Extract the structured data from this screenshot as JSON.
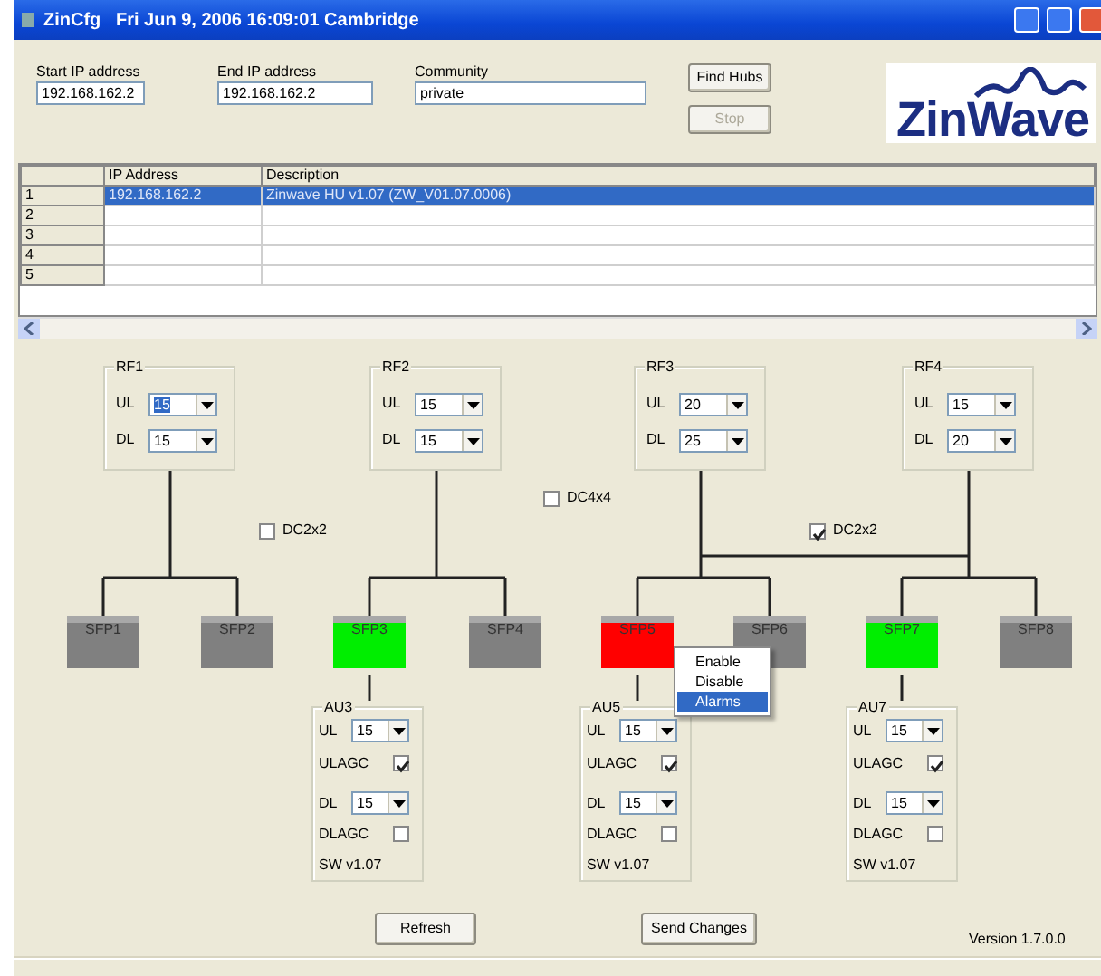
{
  "window": {
    "title": "ZinCfg   Fri Jun 9, 2006 16:09:01 Cambridge"
  },
  "fields": [
    {
      "label": "Start IP address",
      "value": "192.168.162.2"
    },
    {
      "label": "End IP address",
      "value": "192.168.162.2"
    },
    {
      "label": "Community",
      "value": "private"
    }
  ],
  "buttons": [
    {
      "label": "Find Hubs",
      "disabled": false
    },
    {
      "label": "Stop",
      "disabled": true
    }
  ],
  "logo": {
    "text": "ZinWave"
  },
  "table": {
    "columns": [
      "IP Address",
      "Description"
    ],
    "rows": [
      {
        "number": "1",
        "ip": "192.168.162.2",
        "description": "Zinwave HU v1.07 (ZW_V01.07.0006)",
        "selected": true
      },
      {
        "number": "2",
        "selected": false
      },
      {
        "number": "3",
        "selected": false
      },
      {
        "number": "4",
        "selected": false
      },
      {
        "number": "5",
        "selected": false
      }
    ]
  },
  "rf_units": [
    {
      "title": "RF1",
      "ul_label": "UL",
      "ul": "15",
      "dl_label": "DL",
      "dl": "15",
      "ul_highlighted": true
    },
    {
      "title": "RF2",
      "ul_label": "UL",
      "ul": "15",
      "dl_label": "DL",
      "dl": "15",
      "ul_highlighted": false
    },
    {
      "title": "RF3",
      "ul_label": "UL",
      "ul": "20",
      "dl_label": "DL",
      "dl": "25",
      "ul_highlighted": false
    },
    {
      "title": "RF4",
      "ul_label": "UL",
      "ul": "15",
      "dl_label": "DL",
      "dl": "20",
      "ul_highlighted": false
    }
  ],
  "combiners": [
    {
      "label": "DC2x2",
      "checked": false
    },
    {
      "label": "DC4x4",
      "checked": false
    },
    {
      "label": "DC2x2",
      "checked": true
    }
  ],
  "sfps": [
    {
      "label": "SFP1",
      "color": "#808080"
    },
    {
      "label": "SFP2",
      "color": "#808080"
    },
    {
      "label": "SFP3",
      "color": "#00ee00"
    },
    {
      "label": "SFP4",
      "color": "#808080"
    },
    {
      "label": "SFP5",
      "color": "#ff0000"
    },
    {
      "label": "SFP6",
      "color": "#808080"
    },
    {
      "label": "SFP7",
      "color": "#00ee00"
    },
    {
      "label": "SFP8",
      "color": "#808080"
    }
  ],
  "au_units": [
    {
      "title": "AU3",
      "ul_label": "UL",
      "ul": "15",
      "ulagc_label": "ULAGC",
      "ulagc": true,
      "dl_label": "DL",
      "dl": "15",
      "dlagc_label": "DLAGC",
      "dlagc": false,
      "sw": "SW v1.07"
    },
    {
      "title": "AU5",
      "ul_label": "UL",
      "ul": "15",
      "ulagc_label": "ULAGC",
      "ulagc": true,
      "dl_label": "DL",
      "dl": "15",
      "dlagc_label": "DLAGC",
      "dlagc": false,
      "sw": "SW v1.07"
    },
    {
      "title": "AU7",
      "ul_label": "UL",
      "ul": "15",
      "ulagc_label": "ULAGC",
      "ulagc": true,
      "dl_label": "DL",
      "dl": "15",
      "dlagc_label": "DLAGC",
      "dlagc": false,
      "sw": "SW v1.07"
    }
  ],
  "context_menu": [
    {
      "label": "Enable",
      "selected": false
    },
    {
      "label": "Disable",
      "selected": false
    },
    {
      "label": "Alarms",
      "selected": true
    }
  ],
  "actions": [
    {
      "label": "Refresh"
    },
    {
      "label": "Send Changes"
    }
  ],
  "version": "Version 1.7.0.0"
}
